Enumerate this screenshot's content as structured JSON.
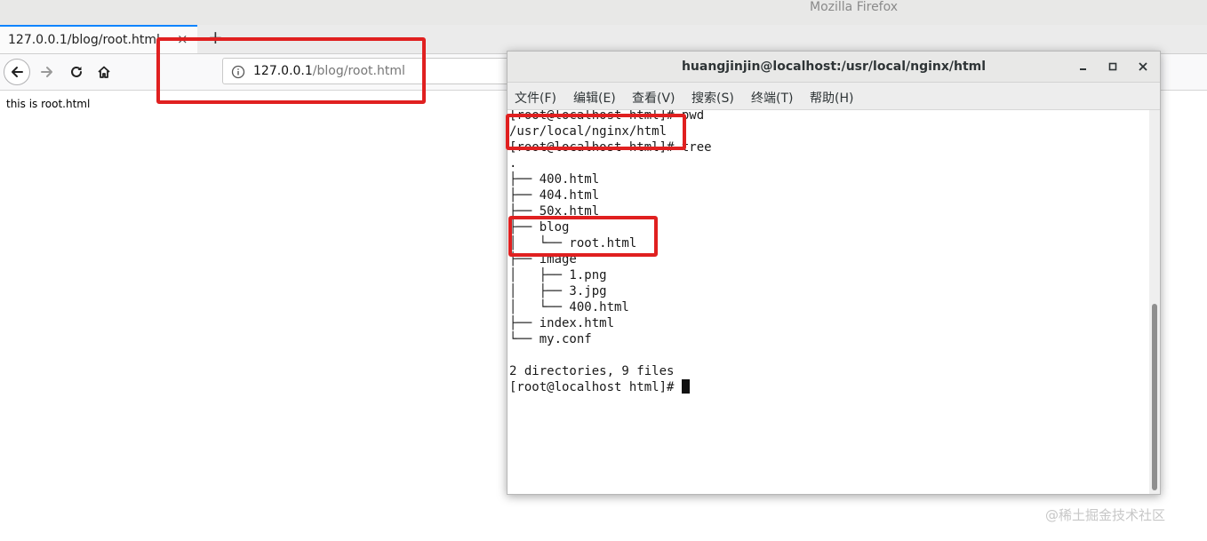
{
  "browser": {
    "window_title": "Mozilla Firefox",
    "tab": {
      "title": "127.0.0.1/blog/root.html",
      "close_glyph": "×",
      "new_tab_glyph": "+"
    },
    "toolbar": {
      "back_icon": "back-arrow-icon",
      "forward_icon": "forward-arrow-icon",
      "reload_icon": "reload-icon",
      "home_icon": "home-icon"
    },
    "url": {
      "host": "127.0.0.1",
      "path": "/blog/root.html",
      "info_icon": "info-icon"
    },
    "page_content": "this is root.html"
  },
  "terminal": {
    "title": "huangjinjin@localhost:/usr/local/nginx/html",
    "window_buttons": [
      "minimize-icon",
      "maximize-icon",
      "close-icon"
    ],
    "menu": [
      "文件(F)",
      "编辑(E)",
      "查看(V)",
      "搜索(S)",
      "终端(T)",
      "帮助(H)"
    ],
    "lines": [
      "[root@localhost html]# pwd",
      "/usr/local/nginx/html",
      "[root@localhost html]# tree",
      ".",
      "├── 400.html",
      "├── 404.html",
      "├── 50x.html",
      "├── blog",
      "│   └── root.html",
      "├── image",
      "│   ├── 1.png",
      "│   ├── 3.jpg",
      "│   └── 400.html",
      "├── index.html",
      "└── my.conf",
      "",
      "2 directories, 9 files"
    ],
    "prompt": "[root@localhost html]# "
  },
  "annotation_color": "#e02020",
  "watermark": "@稀土掘金技术社区"
}
